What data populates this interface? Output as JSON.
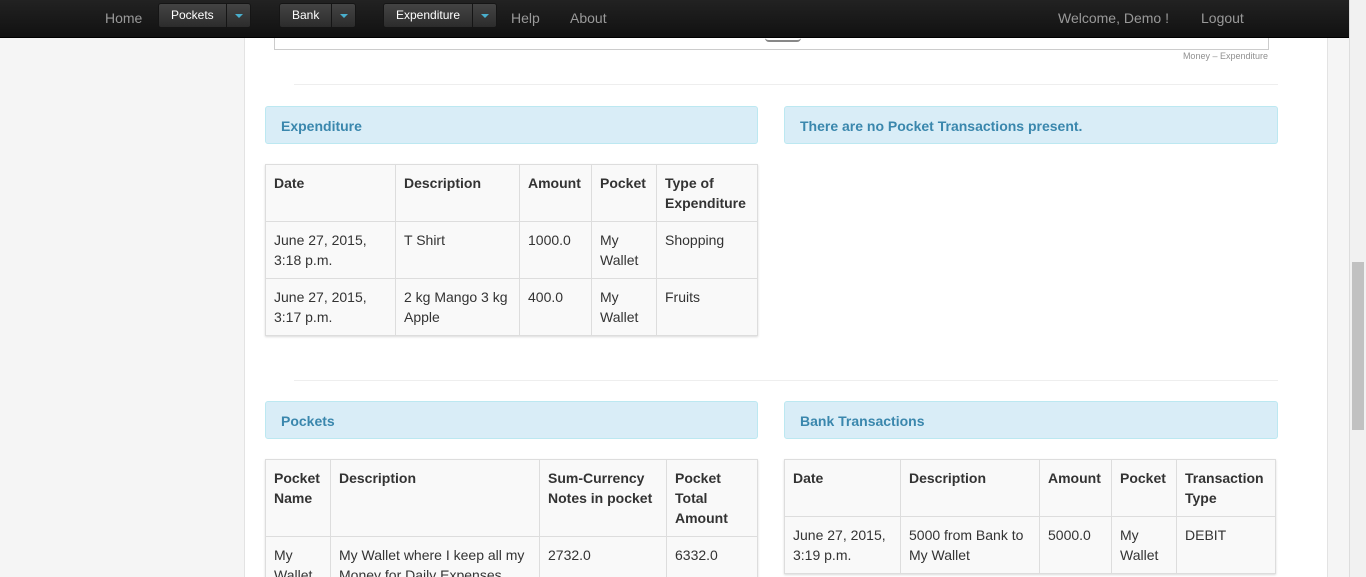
{
  "nav": {
    "home": "Home",
    "pockets": "Pockets",
    "bank": "Bank",
    "expenditure": "Expenditure",
    "help": "Help",
    "about": "About",
    "welcome": "Welcome, Demo !",
    "logout": "Logout"
  },
  "chart": {
    "credit": "Money – Expenditure"
  },
  "expenditure": {
    "title": "Expenditure",
    "headers": [
      "Date",
      "Description",
      "Amount",
      "Pocket",
      "Type of Expenditure"
    ],
    "rows": [
      [
        "June 27, 2015, 3:18 p.m.",
        "T Shirt",
        "1000.0",
        "My Wallet",
        "Shopping"
      ],
      [
        "June 27, 2015, 3:17 p.m.",
        "2 kg Mango 3 kg Apple",
        "400.0",
        "My Wallet",
        "Fruits"
      ]
    ]
  },
  "pocket_transactions": {
    "message": "There are no Pocket Transactions present."
  },
  "pockets": {
    "title": "Pockets",
    "headers": [
      "Pocket Name",
      "Description",
      "Sum-Currency Notes in pocket",
      "Pocket Total Amount"
    ],
    "rows": [
      [
        "My Wallet",
        "My Wallet where I keep all my Money for Daily Expenses",
        "2732.0",
        "6332.0"
      ]
    ]
  },
  "bank_transactions": {
    "title": "Bank Transactions",
    "headers": [
      "Date",
      "Description",
      "Amount",
      "Pocket",
      "Transaction Type"
    ],
    "rows": [
      [
        "June 27, 2015, 3:19 p.m.",
        "5000 from Bank to My Wallet",
        "5000.0",
        "My Wallet",
        "DEBIT"
      ]
    ]
  }
}
